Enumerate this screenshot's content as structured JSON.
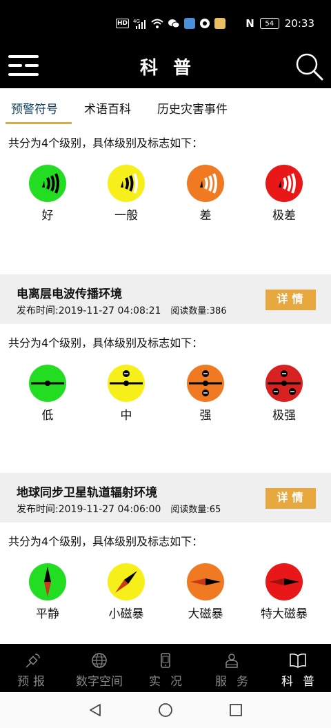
{
  "status_bar": {
    "left_icons": [
      "hd-icon",
      "signal-4g-icon",
      "wifi-icon",
      "wechat-icon",
      "mail-icon",
      "notification-icon",
      "app-icon"
    ],
    "hd_text": "HD",
    "net_text": "4G",
    "nfc_text": "N",
    "battery": "54",
    "time": "20:33"
  },
  "header": {
    "title": "科普"
  },
  "tabs": [
    {
      "label": "预警符号",
      "active": true
    },
    {
      "label": "术语百科",
      "active": false
    },
    {
      "label": "历史灾害事件",
      "active": false
    }
  ],
  "sections": [
    {
      "desc": "共分为4个级别，具体级别及标志如下：",
      "levels": [
        {
          "label": "好",
          "color": "#22dd22"
        },
        {
          "label": "一般",
          "color": "#f7ef1a"
        },
        {
          "label": "差",
          "color": "#f07a22"
        },
        {
          "label": "极差",
          "color": "#e81818"
        }
      ]
    },
    {
      "title": "电离层电波传播环境",
      "publish": "发布时间:2019-11-27 04:08:21",
      "reads": "阅读数量:386",
      "detail": "详情",
      "desc": "共分为4个级别，具体级别及标志如下：",
      "levels": [
        {
          "label": "低",
          "color": "#22dd22"
        },
        {
          "label": "中",
          "color": "#f7ef1a"
        },
        {
          "label": "强",
          "color": "#f07a22"
        },
        {
          "label": "极强",
          "color": "#d82222"
        }
      ]
    },
    {
      "title": "地球同步卫星轨道辐射环境",
      "publish": "发布时间:2019-11-27 04:06:00",
      "reads": "阅读数量:65",
      "detail": "详情",
      "desc": "共分为4个级别，具体级别及标志如下：",
      "levels": [
        {
          "label": "平静",
          "color": "#22dd22"
        },
        {
          "label": "小磁暴",
          "color": "#f7ef1a"
        },
        {
          "label": "大磁暴",
          "color": "#f07a22"
        },
        {
          "label": "特大磁暴",
          "color": "#e81818"
        }
      ]
    }
  ],
  "bottom_nav": [
    {
      "label": "预报",
      "icon": "satellite-icon",
      "active": false
    },
    {
      "label": "数字空间",
      "icon": "globe-icon",
      "active": false
    },
    {
      "label": "实况",
      "icon": "phone-icon",
      "active": false
    },
    {
      "label": "服务",
      "icon": "service-icon",
      "active": false
    },
    {
      "label": "科普",
      "icon": "book-icon",
      "active": true
    }
  ]
}
